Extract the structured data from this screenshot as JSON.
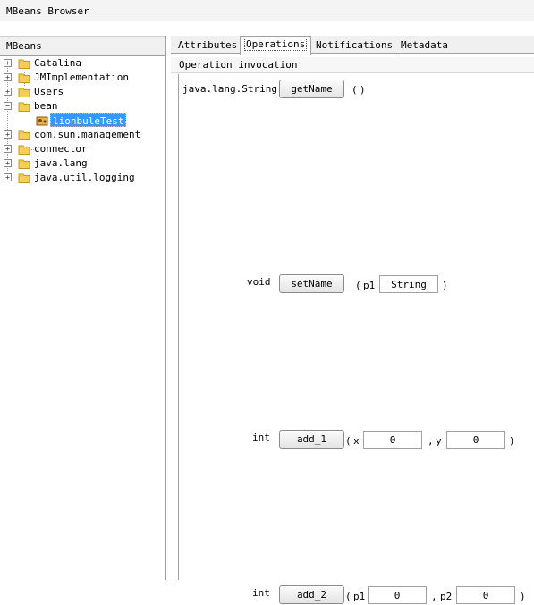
{
  "window": {
    "title": "MBeans Browser"
  },
  "left": {
    "header": "MBeans",
    "tree": [
      {
        "label": "Catalina",
        "expander": "+"
      },
      {
        "label": "JMImplementation",
        "expander": "+"
      },
      {
        "label": "Users",
        "expander": "+"
      },
      {
        "label": "bean",
        "expander": "−"
      },
      {
        "label": "lionbuleTest",
        "selected": true
      },
      {
        "label": "com.sun.management",
        "expander": "+"
      },
      {
        "label": "connector",
        "expander": "+"
      },
      {
        "label": "java.lang",
        "expander": "+"
      },
      {
        "label": "java.util.logging",
        "expander": "+"
      }
    ]
  },
  "tabs": [
    {
      "label": "Attributes"
    },
    {
      "label": "Operations",
      "active": true
    },
    {
      "label": "Notifications"
    },
    {
      "label": "Metadata"
    }
  ],
  "section_title": "Operation invocation",
  "operations": [
    {
      "return_type": "java.lang.String",
      "button": "getName",
      "open": "(",
      "close": ")",
      "params": []
    },
    {
      "return_type": "void",
      "button": "setName",
      "open": "(",
      "close": ")",
      "params": [
        {
          "name": "p1",
          "value": "String"
        }
      ]
    },
    {
      "return_type": "int",
      "button": "add_1",
      "open": "(",
      "close": ")",
      "separator": ",",
      "params": [
        {
          "name": "x",
          "value": "0"
        },
        {
          "name": "y",
          "value": "0"
        }
      ]
    },
    {
      "return_type": "int",
      "button": "add_2",
      "open": "(",
      "close": ")",
      "separator": ",",
      "params": [
        {
          "name": "p1",
          "value": "0"
        },
        {
          "name": "p2",
          "value": "0"
        }
      ]
    }
  ]
}
